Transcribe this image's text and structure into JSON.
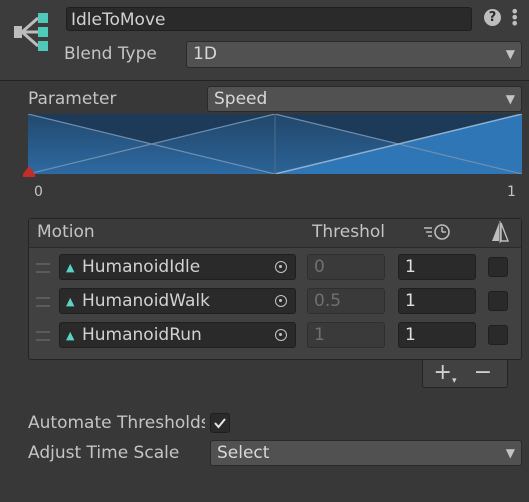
{
  "header": {
    "name": "IdleToMove",
    "blend_type_label": "Blend Type",
    "blend_type_value": "1D",
    "help_icon": "?",
    "menu_icon": "⋮"
  },
  "parameter": {
    "label": "Parameter",
    "value": "Speed"
  },
  "graph": {
    "min_label": "0",
    "max_label": "1"
  },
  "table": {
    "col_motion": "Motion",
    "col_threshold": "Threshol",
    "rows": [
      {
        "clip": "HumanoidIdle",
        "threshold": "0",
        "speed": "1",
        "mirror": false
      },
      {
        "clip": "HumanoidWalk",
        "threshold": "0.5",
        "speed": "1",
        "mirror": false
      },
      {
        "clip": "HumanoidRun",
        "threshold": "1",
        "speed": "1",
        "mirror": false
      }
    ],
    "add_label": "+",
    "remove_label": "−"
  },
  "options": {
    "automate_label": "Automate Thresholds",
    "automate_checked": true,
    "adjust_label": "Adjust Time Scale",
    "adjust_value": "Select"
  },
  "colors": {
    "background": "#383838",
    "graph_fill": "#1a3550",
    "clip_icon": "#58d3c6",
    "root_marker": "#c42b2b"
  }
}
